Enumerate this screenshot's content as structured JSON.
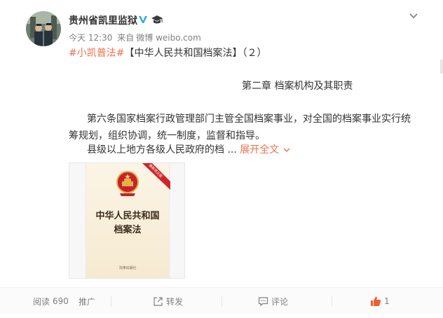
{
  "post": {
    "author_name": "贵州省凯里监狱",
    "timestamp": "今天 12:30",
    "source_prefix": "来自",
    "source": "微博 weibo.com",
    "hashtag": "#小凯普法#",
    "title": "【中华人民共和国档案法】（２）",
    "chapter_heading": "第二章 档案机构及其职责",
    "paragraph1": "第六条国家档案行政管理部门主管全国档案事业，对全国的档案事业实行统筹规划，组织协调，统一制度，监督和指导。",
    "paragraph2_preview": "县级以上地方各级人民政府的档 ...",
    "expand_label": "展开全文",
    "image": {
      "book_title_line1": "中华人民共和国",
      "book_title_line2": "档案法",
      "ribbon_text": "最新修正版",
      "publisher": "法律出版社"
    }
  },
  "actions": {
    "reads_label": "阅读",
    "reads_count": "690",
    "promote_label": "推广",
    "repost_label": "转发",
    "comment_label": "评论",
    "like_count": "1"
  },
  "colors": {
    "accent": "#eb7350",
    "text": "#333333",
    "muted": "#808080",
    "verified": "#2aa8e7",
    "like": "#f25e2f"
  },
  "icons": [
    "avatar",
    "verified-badge-icon",
    "graduate-cap-icon",
    "chevron-down-icon",
    "expand-chevron-icon",
    "repost-icon",
    "comment-icon",
    "like-icon"
  ]
}
